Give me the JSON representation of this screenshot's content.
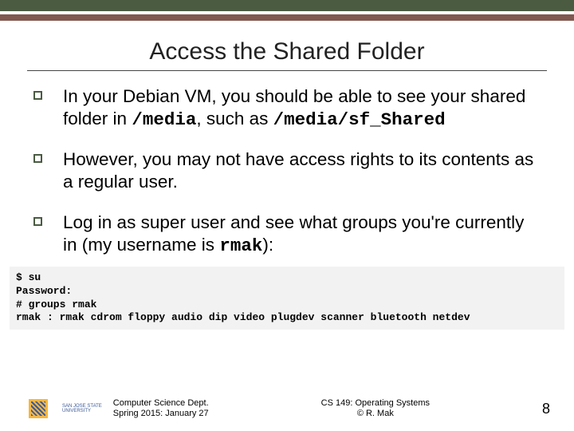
{
  "title": "Access the Shared Folder",
  "bullets": {
    "b1_pre": "In your Debian VM, you should be able to see your shared folder in ",
    "b1_code1": "/media",
    "b1_mid": ", such as ",
    "b1_code2": "/media/sf_Shared",
    "b2": "However, you may not have access rights to its contents as a regular user.",
    "b3_pre": "Log in as super user and see what groups you're currently in (my username is ",
    "b3_code": "rmak",
    "b3_post": "):"
  },
  "terminal": "$ su\nPassword:\n# groups rmak\nrmak : rmak cdrom floppy audio dip video plugdev scanner bluetooth netdev",
  "footer": {
    "univ1": "SAN JOSE STATE",
    "univ2": "UNIVERSITY",
    "dept1": "Computer Science Dept.",
    "dept2": "Spring 2015: January 27",
    "course1": "CS 149: Operating Systems",
    "course2": "© R. Mak",
    "page": "8"
  }
}
